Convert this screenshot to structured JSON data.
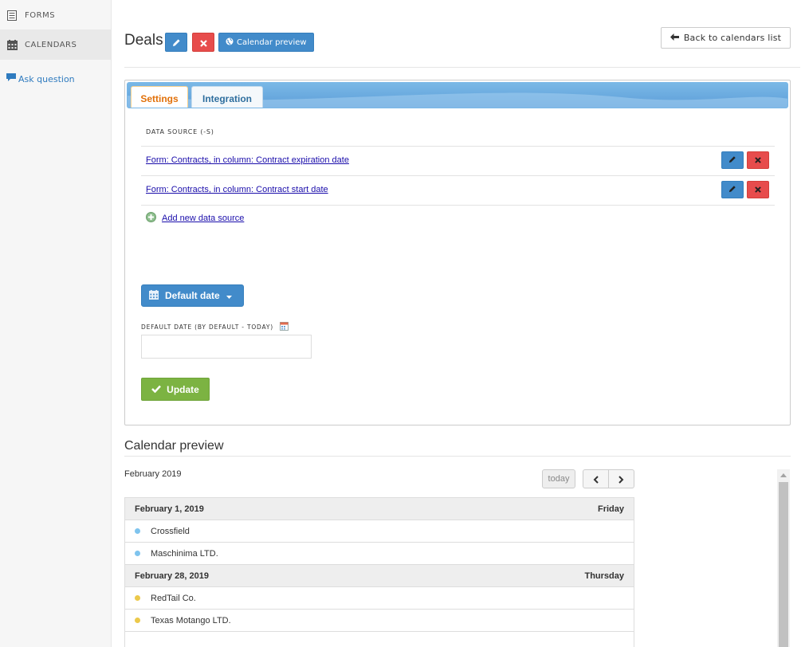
{
  "sidebar": {
    "items": [
      {
        "label": "FORMS",
        "icon": "forms-icon"
      },
      {
        "label": "CALENDARS",
        "icon": "calendar-icon"
      }
    ],
    "ask_question": "Ask question"
  },
  "header": {
    "title": "Deals",
    "calendar_preview_label": "Calendar preview",
    "back_label": "Back to calendars list"
  },
  "tabs": [
    {
      "label": "Settings",
      "active": true
    },
    {
      "label": "Integration",
      "active": false
    }
  ],
  "settings": {
    "data_source_label": "DATA SOURCE (-S)",
    "sources": [
      "Form: Contracts, in column: Contract expiration date",
      "Form: Contracts, in column: Contract start date"
    ],
    "add_source_label": "Add new data source",
    "default_date_button": "Default date",
    "default_date_label": "DEFAULT DATE (BY DEFAULT - TODAY)",
    "default_date_value": "",
    "update_label": "Update"
  },
  "calendar_preview": {
    "title": "Calendar preview",
    "month": "February 2019",
    "today_label": "today",
    "days": [
      {
        "date": "February 1, 2019",
        "weekday": "Friday",
        "color": "#7fc4ee",
        "events": [
          "Crossfield",
          "Maschinima LTD."
        ]
      },
      {
        "date": "February 28, 2019",
        "weekday": "Thursday",
        "color": "#ecc94b",
        "events": [
          "RedTail Co.",
          "Texas Motango LTD."
        ]
      }
    ]
  },
  "colors": {
    "primary": "#428bca",
    "danger": "#e74c4c",
    "success": "#7cb342",
    "active_tab_text": "#e17009"
  }
}
